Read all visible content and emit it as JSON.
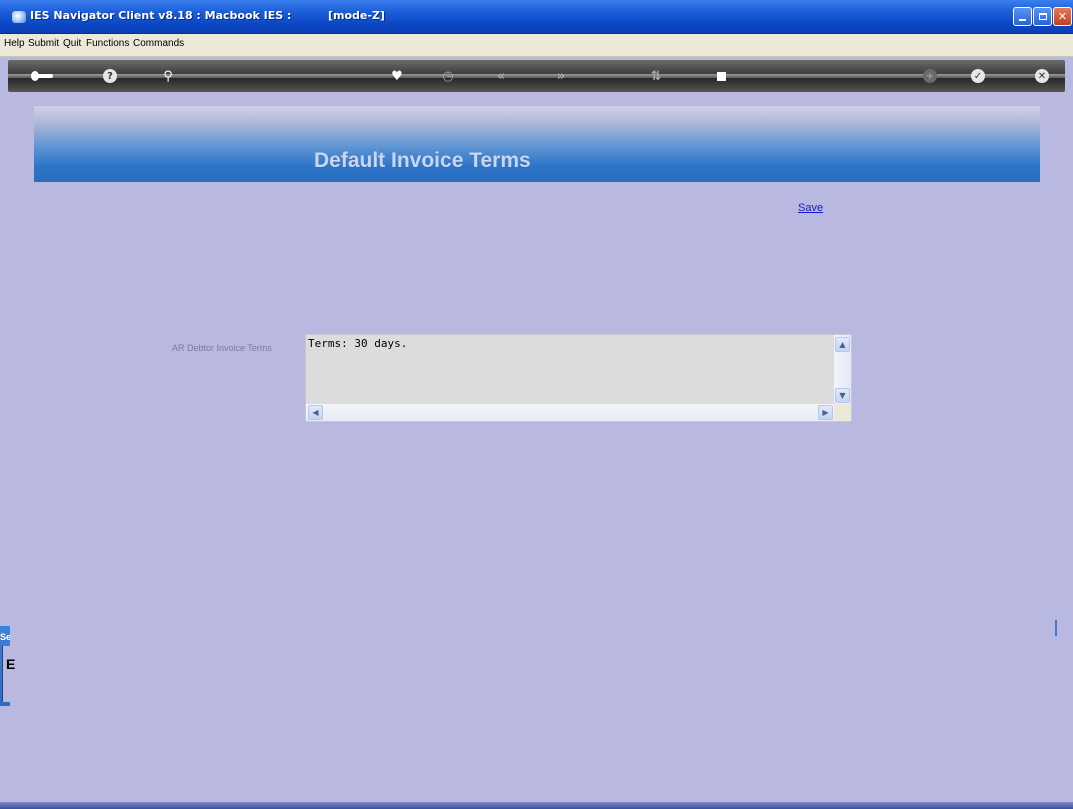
{
  "window": {
    "title": "IES Navigator Client v8.18 : Macbook IES :",
    "mode": "[mode-Z]"
  },
  "menu": {
    "items": [
      "Help",
      "Submit",
      "Quit",
      "Functions",
      "Commands"
    ]
  },
  "toolbar": {
    "icons": [
      "key-icon",
      "help-icon",
      "search-icon",
      "heart-icon",
      "clock-icon",
      "rewind-icon",
      "fast-forward-icon",
      "sort-icon",
      "stop-icon",
      "add-icon",
      "check-icon",
      "close-icon"
    ]
  },
  "page": {
    "title": "Default Invoice Terms",
    "save_label": "Save"
  },
  "form": {
    "field_label": "AR Debtor Invoice Terms",
    "field_value": "Terms: 30 days."
  },
  "side": {
    "tab_text": "Se",
    "panel_char": "E"
  },
  "colors": {
    "background": "#b9b8e0",
    "banner_blue": "#2a6ebf",
    "link": "#1a1ad0",
    "titlebar": "#0a46c4"
  }
}
